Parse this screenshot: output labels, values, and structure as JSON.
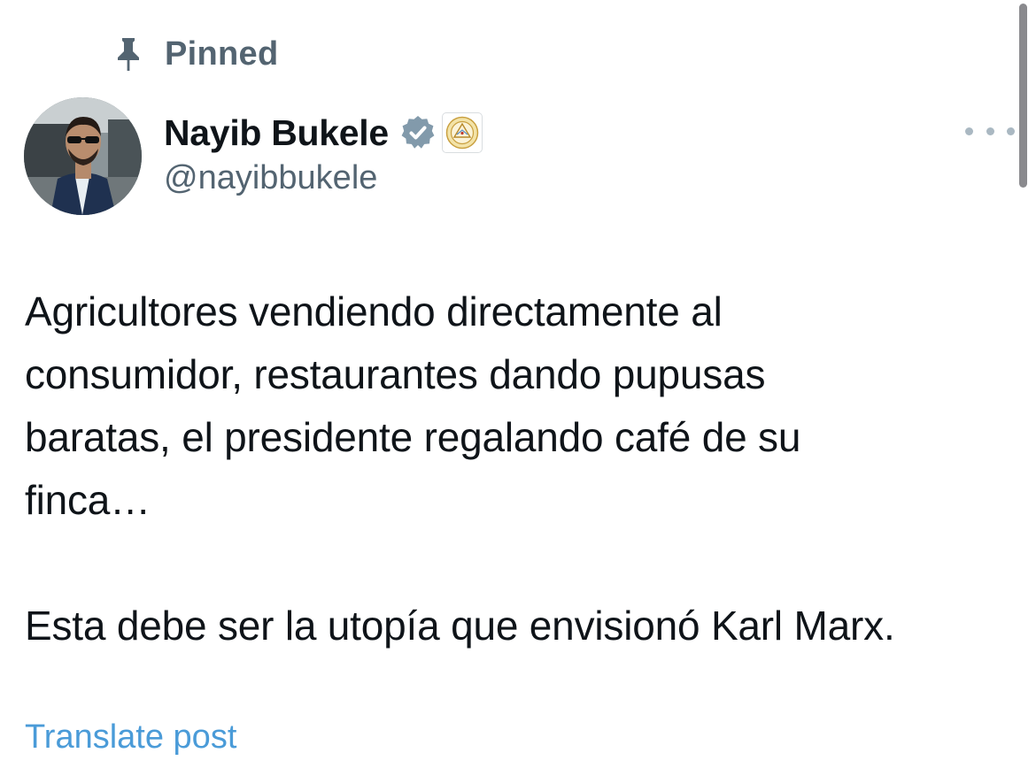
{
  "pinned": {
    "label": "Pinned",
    "icon": "pin-icon"
  },
  "author": {
    "display_name": "Nayib Bukele",
    "handle": "@nayibbukele",
    "verified_icon": "verified-badge-icon",
    "verified_color": "#829aab",
    "affiliate_badge": "government-seal-icon"
  },
  "menu": {
    "icon": "more-options-icon"
  },
  "tweet": {
    "paragraphs": [
      "Agricultores vendiendo directamente al\nconsumidor, restaurantes dando pupusas\nbaratas, el presidente regalando café de su\nfinca…",
      "Esta debe ser la utopía que envisionó Karl Marx."
    ]
  },
  "translate": {
    "label": "Translate post",
    "color": "#4a9bd8"
  },
  "colors": {
    "text_primary": "#0f1419",
    "text_secondary": "#536471",
    "background": "#ffffff"
  }
}
